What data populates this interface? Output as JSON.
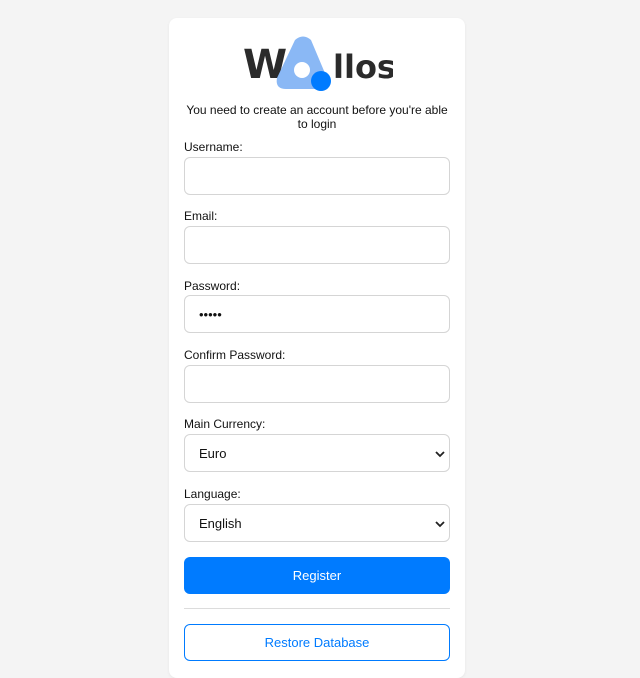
{
  "brand": {
    "name": "Wallos",
    "logo_left": "W",
    "logo_right": "llos",
    "accent_color": "#007bff",
    "accent_light": "#8ab8f5"
  },
  "intro_text": "You need to create an account before you're able to login",
  "form": {
    "username_label": "Username:",
    "username_value": "",
    "email_label": "Email:",
    "email_value": "",
    "password_label": "Password:",
    "password_value": "•••••",
    "confirm_password_label": "Confirm Password:",
    "confirm_password_value": "",
    "currency_label": "Main Currency:",
    "currency_selected": "Euro",
    "language_label": "Language:",
    "language_selected": "English"
  },
  "actions": {
    "register_label": "Register",
    "restore_label": "Restore Database"
  },
  "icons": {
    "select_arrow": "chevron-down-icon"
  }
}
